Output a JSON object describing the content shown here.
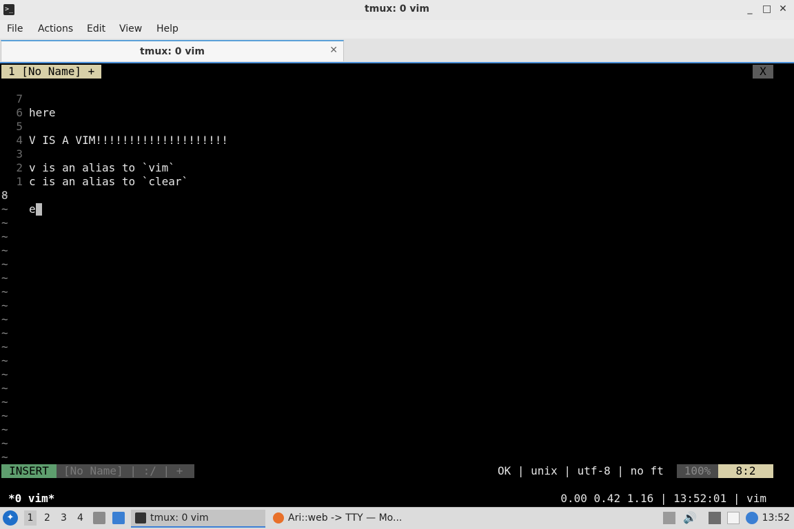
{
  "window": {
    "title": "tmux: 0 vim",
    "controls": {
      "minimize": "_",
      "maximize": "□",
      "close": "✕"
    }
  },
  "menu": [
    "File",
    "Actions",
    "Edit",
    "View",
    "Help"
  ],
  "tab": {
    "label": "tmux: 0 vim",
    "close": "✕"
  },
  "vim": {
    "buffer_tab": "1 [No Name] +",
    "buffer_close": "X",
    "lines": [
      {
        "num": "7",
        "text": "here"
      },
      {
        "num": "6",
        "text": ""
      },
      {
        "num": "5",
        "text": "V IS A VIM!!!!!!!!!!!!!!!!!!!!"
      },
      {
        "num": "4",
        "text": ""
      },
      {
        "num": "3",
        "text": "v is an alias to `vim`"
      },
      {
        "num": "2",
        "text": "c is an alias to `clear`"
      },
      {
        "num": "1",
        "text": ""
      }
    ],
    "current_line": {
      "num": "8",
      "text": "e"
    },
    "tilde": "~",
    "statusline": {
      "mode": "INSERT",
      "file": "[No Name]  |  :/  |  +",
      "right": "OK | unix | utf-8 | no ft",
      "percent": "100%",
      "position": "8:2"
    }
  },
  "tmux": {
    "left": "*0 vim*",
    "right": "0.00 0.42 1.16 | 13:52:01 | vim"
  },
  "taskbar": {
    "workspaces": [
      "1",
      "2",
      "3",
      "4"
    ],
    "tasks": [
      {
        "label": "tmux: 0 vim",
        "active": true
      },
      {
        "label": "Ari::web -> TTY — Mo...",
        "active": false
      }
    ],
    "clock": "13:52"
  }
}
